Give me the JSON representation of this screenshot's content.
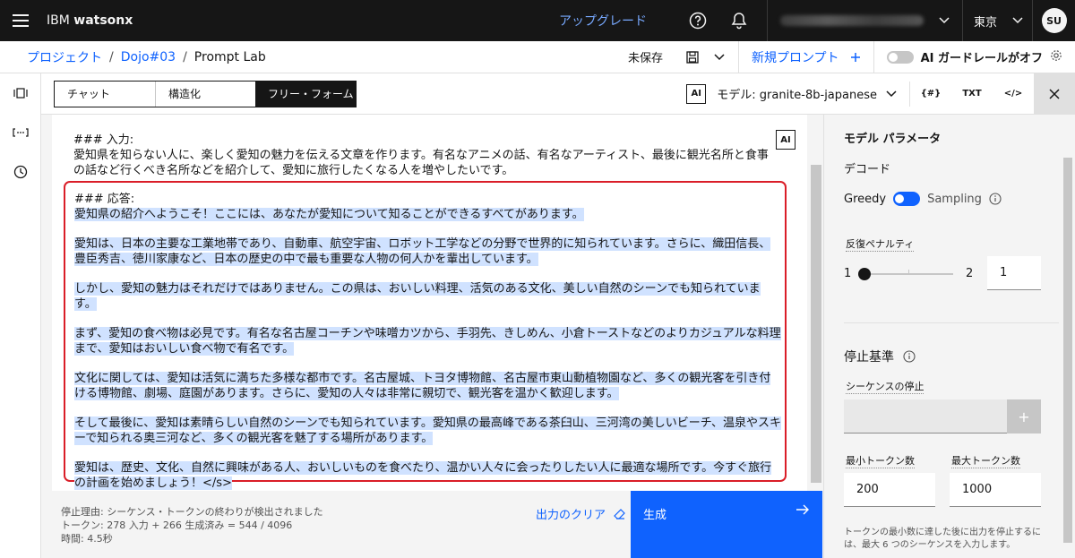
{
  "header": {
    "brand_prefix": "IBM",
    "brand_name": "watsonx",
    "upgrade": "アップグレード",
    "region": "東京",
    "avatar": "SU"
  },
  "breadcrumb": {
    "items": [
      "プロジェクト",
      "Dojo#03",
      "Prompt Lab"
    ],
    "separator": "/"
  },
  "toolbar": {
    "unsaved": "未保存",
    "new_prompt": "新規プロンプト",
    "guardrail": "AI ガードレールがオフ"
  },
  "modes": {
    "chat": "チャット",
    "structured": "構造化",
    "freeform": "フリー・フォーム",
    "active": "フリー・フォーム"
  },
  "model": {
    "ai_badge": "AI",
    "label": "モデル: granite-8b-japanese",
    "tool_vars": "{#}",
    "tool_txt": "TXT",
    "tool_code": "</>"
  },
  "editor": {
    "ai_badge": "AI",
    "prompt_header": "### 入力:",
    "prompt_text": "愛知県を知らない人に、楽しく愛知の魅力を伝える文章を作ります。有名なアニメの話、有名なアーティスト、最後に観光名所と食事の話など行くべき名所などを紹介して、愛知に旅行したくなる人を増やしたいです。",
    "response_header": "### 応答:",
    "response_paragraphs": [
      "愛知県の紹介へようこそ！ここには、あなたが愛知について知ることができるすべてがあります。",
      "愛知は、日本の主要な工業地帯であり、自動車、航空宇宙、ロボット工学などの分野で世界的に知られています。さらに、織田信長、豊臣秀吉、徳川家康など、日本の歴史の中で最も重要な人物の何人かを輩出しています。",
      "しかし、愛知の魅力はそれだけではありません。この県は、おいしい料理、活気のある文化、美しい自然のシーンでも知られています。",
      "まず、愛知の食べ物は必見です。有名な名古屋コーチンや味噌カツから、手羽先、きしめん、小倉トーストなどのよりカジュアルな料理まで、愛知はおいしい食べ物で有名です。",
      "文化に関しては、愛知は活気に満ちた多様な都市です。名古屋城、トヨタ博物館、名古屋市東山動植物園など、多くの観光客を引き付ける博物館、劇場、庭園があります。さらに、愛知の人々は非常に親切で、観光客を温かく歓迎します。",
      "そして最後に、愛知は素晴らしい自然のシーンでも知られています。愛知県の最高峰である茶臼山、三河湾の美しいビーチ、温泉やスキーで知られる奥三河など、多くの観光客を魅了する場所があります。",
      "愛知は、歴史、文化、自然に興味がある人、おいしいものを食べたり、温かい人々に会ったりしたい人に最適な場所です。今すぐ旅行の計画を始めましょう！</s>"
    ]
  },
  "footer": {
    "stop_reason": "停止理由: シーケンス・トークンの終わりが検出されました",
    "tokens": "トークン: 278 入力 + 266 生成済み = 544 / 4096",
    "time": "時間: 4.5秒",
    "clear_output": "出力のクリア",
    "generate": "生成"
  },
  "params": {
    "title": "モデル パラメータ",
    "decoding": "デコード",
    "greedy": "Greedy",
    "sampling": "Sampling",
    "decoding_mode": "Greedy",
    "repetition_penalty_label": "反復ペナルティ",
    "slider_min": "1",
    "slider_max": "2",
    "repetition_penalty_value": "1",
    "stopping_criteria": "停止基準",
    "stop_sequences_label": "シーケンスの停止",
    "min_tokens_label": "最小トークン数",
    "max_tokens_label": "最大トークン数",
    "min_tokens": "200",
    "max_tokens": "1000",
    "help_note": "トークンの最小数に達した後に出力を停止するには、最大 6 つのシーケンスを入力します。"
  },
  "colors": {
    "accent": "#0f62fe",
    "highlight": "#d0e2ff",
    "response_border": "#da1e28",
    "header_bg": "#161616"
  }
}
